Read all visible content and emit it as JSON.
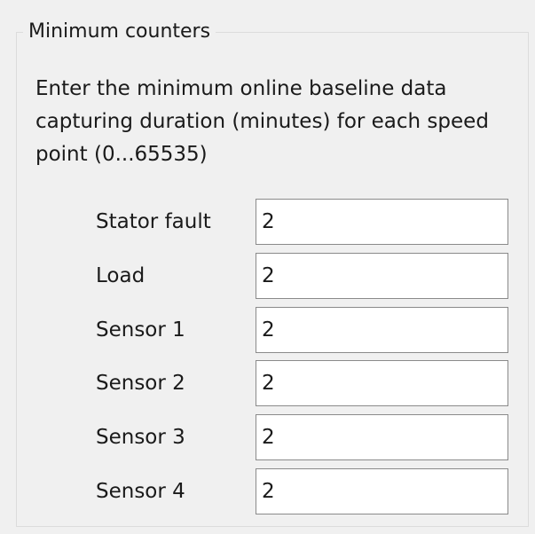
{
  "group": {
    "title": "Minimum counters",
    "description": "Enter the minimum online baseline data capturing duration (minutes) for each speed point (0...65535)"
  },
  "fields": [
    {
      "label": "Stator fault",
      "value": "2"
    },
    {
      "label": "Load",
      "value": "2"
    },
    {
      "label": "Sensor 1",
      "value": "2"
    },
    {
      "label": "Sensor 2",
      "value": "2"
    },
    {
      "label": "Sensor 3",
      "value": "2"
    },
    {
      "label": "Sensor 4",
      "value": "2"
    }
  ]
}
